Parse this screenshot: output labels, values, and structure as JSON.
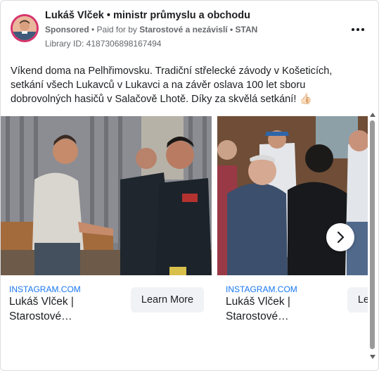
{
  "header": {
    "page_name": "Lukáš Vlček • ministr průmyslu a obchodu",
    "sponsored": "Sponsored",
    "sep1": " • ",
    "paid_for_prefix": "Paid for by ",
    "payer": "Starostové a nezávislí • STAN",
    "library_id": "Library ID: 4187306898167494"
  },
  "post": {
    "text": "Víkend doma na Pelhřimovsku. Tradiční střelecké závody v Košeticích, setkání všech Lukavců v Lukavci a na závěr oslava 100 let sboru dobrovolných hasičů v Salačově Lhotě. Díky za skvělá setkání! 👍🏻"
  },
  "carousel": {
    "cards": [
      {
        "domain": "INSTAGRAM.COM",
        "title": "Lukáš Vlček | Starostové…",
        "cta": "Learn More"
      },
      {
        "domain": "INSTAGRAM.COM",
        "title": "Lukáš Vlček | Starostové…",
        "cta": "Learn More"
      }
    ]
  },
  "colors": {
    "link": "#1877f2",
    "secondary_text": "#65676b",
    "button_bg": "#f0f2f5",
    "avatar_ring": "#d6336c"
  },
  "icons": {
    "more": "more-horizontal-icon",
    "next": "chevron-right-icon"
  }
}
